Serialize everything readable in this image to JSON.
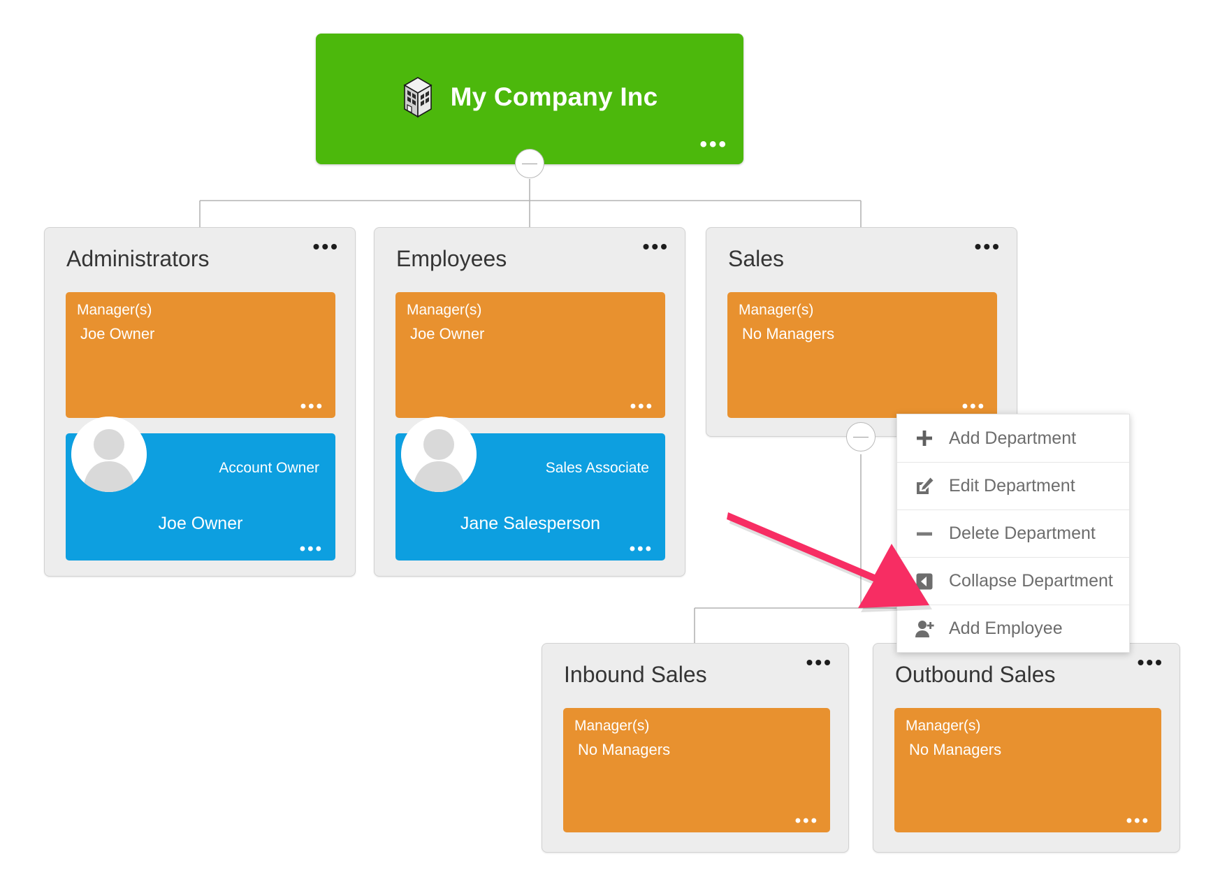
{
  "company": {
    "name": "My Company Inc",
    "icon": "building-icon",
    "menu_dots": "•••",
    "color": "#4CB80C"
  },
  "labels": {
    "managers_heading": "Manager(s)",
    "no_managers": "No Managers",
    "menu_dots": "•••"
  },
  "colors": {
    "company_green": "#4CB80C",
    "manager_orange": "#E8912F",
    "employee_blue": "#0D9FE0",
    "department_gray": "#EDEDED",
    "arrow_pink": "#F72D63"
  },
  "departments": [
    {
      "id": "administrators",
      "title": "Administrators",
      "managers_heading": "Manager(s)",
      "manager_name": "Joe Owner",
      "employee": {
        "role": "Account Owner",
        "name": "Joe Owner",
        "avatar": "person-avatar-icon"
      }
    },
    {
      "id": "employees",
      "title": "Employees",
      "managers_heading": "Manager(s)",
      "manager_name": "Joe Owner",
      "employee": {
        "role": "Sales Associate",
        "name": "Jane Salesperson",
        "avatar": "person-avatar-icon"
      }
    },
    {
      "id": "sales",
      "title": "Sales",
      "managers_heading": "Manager(s)",
      "manager_name": "No Managers",
      "employee": null
    },
    {
      "id": "inbound-sales",
      "title": "Inbound Sales",
      "managers_heading": "Manager(s)",
      "manager_name": "No Managers",
      "employee": null
    },
    {
      "id": "outbound-sales",
      "title": "Outbound Sales",
      "managers_heading": "Manager(s)",
      "manager_name": "No Managers",
      "employee": null
    }
  ],
  "context_menu": {
    "items": [
      {
        "label": "Add Department",
        "icon": "plus-icon"
      },
      {
        "label": "Edit Department",
        "icon": "edit-pencil-icon"
      },
      {
        "label": "Delete Department",
        "icon": "minus-icon"
      },
      {
        "label": "Collapse Department",
        "icon": "collapse-left-icon"
      },
      {
        "label": "Add Employee",
        "icon": "add-person-icon"
      }
    ]
  },
  "annotation": {
    "arrow": "pink-pointer-arrow",
    "points_to": "Add Employee"
  }
}
